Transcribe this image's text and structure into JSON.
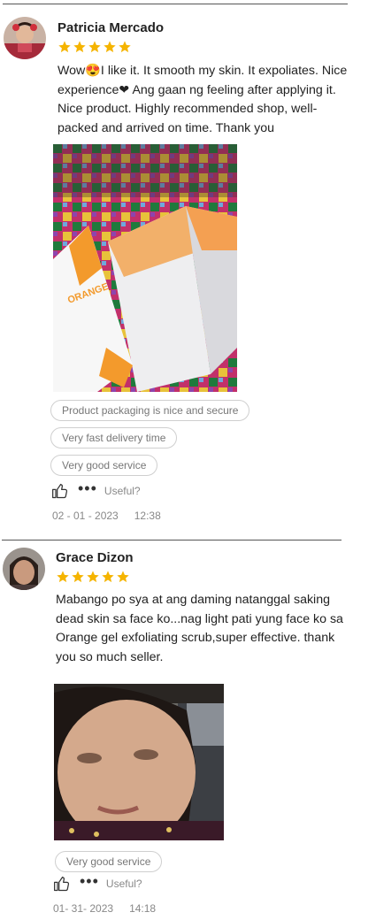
{
  "reviews": [
    {
      "name": "Patricia Mercado",
      "rating": 5,
      "text": "Wow😍I like it. It smooth my skin. It expoliates. Nice experience❤ Ang gaan ng feeling after applying it. Nice product. Highly recommended shop, well-packed and arrived on time. Thank you",
      "photo_caption": "ORANGE",
      "tags": [
        "Product packaging is nice and secure",
        "Very fast delivery time",
        "Very good service"
      ],
      "useful_label": "Useful?",
      "more_icon": "dots",
      "like_icon": "thumbs-up-outline",
      "date": "02 - 01 - 2023",
      "time": "12:38"
    },
    {
      "name": "Grace Dizon",
      "rating": 5,
      "text": "Mabango po sya at ang daming natanggal saking dead skin sa face ko...nag light pati yung face ko sa Orange gel exfoliating scrub,super effective. thank you so much seller.",
      "tags": [
        "Very good service"
      ],
      "useful_label": "Useful?",
      "more_icon": "dots",
      "like_icon": "thumbs-up-outline",
      "date": "01- 31- 2023",
      "time": "14:18"
    }
  ],
  "colors": {
    "star": "#f5b400",
    "tag_border": "#cfcfcf",
    "muted_text": "#888888"
  }
}
